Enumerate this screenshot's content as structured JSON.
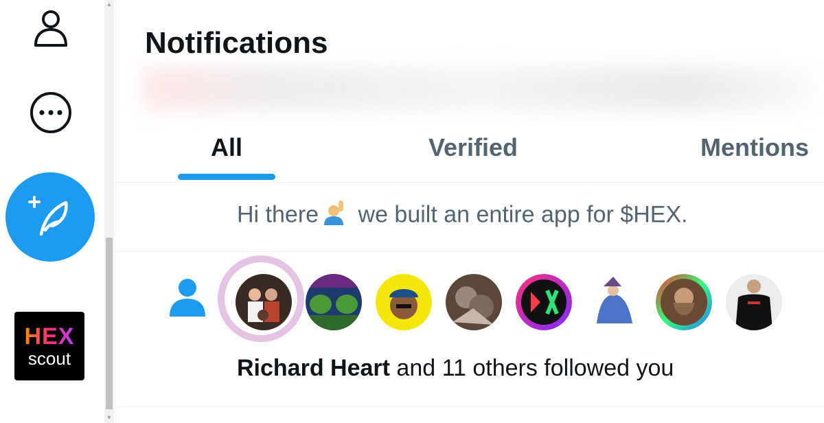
{
  "nav": {
    "profile_icon": "person-outline-icon",
    "more_icon": "more-circle-icon",
    "compose_icon": "feather-plus-icon",
    "app_logo": {
      "line1": "HEX",
      "line2": "scout"
    }
  },
  "header": {
    "title": "Notifications"
  },
  "tabs": [
    {
      "label": "All",
      "active": true
    },
    {
      "label": "Verified",
      "active": false
    },
    {
      "label": "Mentions",
      "active": false
    }
  ],
  "promo": {
    "text_before": "Hi there",
    "text_after": "we built an entire app for $HEX."
  },
  "follow_notification": {
    "icon": "person-filled-icon",
    "name": "Richard Heart",
    "suffix": "and 11 others followed you",
    "avatars": [
      "richard-heart",
      "frogs",
      "yellow-cap",
      "creature",
      "hex-x",
      "ice-wizard",
      "bearded-man",
      "tshirt-man"
    ]
  },
  "colors": {
    "accent": "#1d9bf0",
    "text": "#0f1419",
    "secondary": "#536471"
  }
}
